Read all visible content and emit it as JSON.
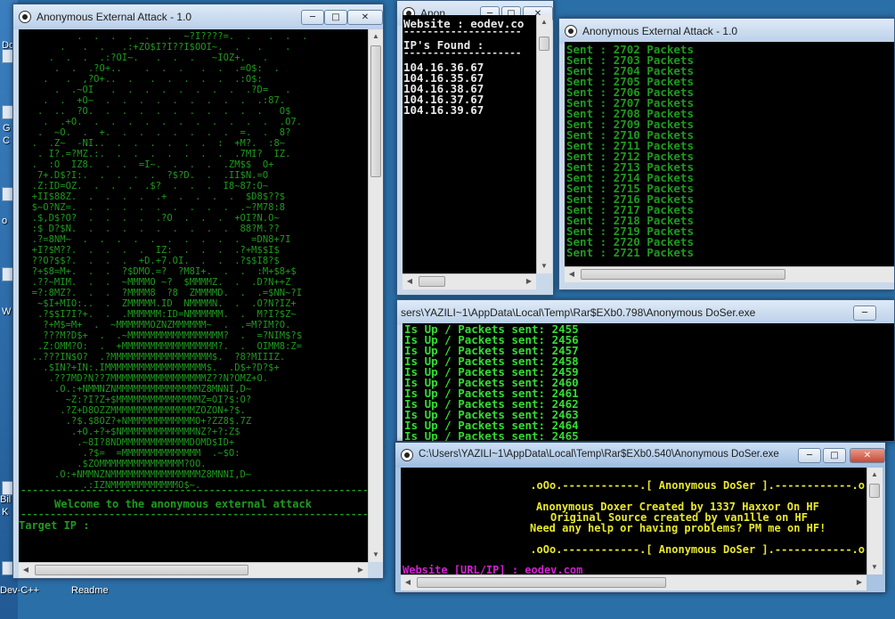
{
  "desktop": {
    "left_labels": [
      "Do",
      "G",
      "C",
      "o",
      "Bil",
      "K",
      "W"
    ],
    "bottom_labels": [
      "Dev-C++",
      "Readme"
    ]
  },
  "win1": {
    "title": "Anonymous External Attack - 1.0",
    "ascii_art": "          .  .  .  .  .   .  ~?I????=.  .   .  .  .\n       .   .  .   .:+ZO$I?I??I$OOI~.  .   .    .\n     .  .  .  .:?OI~.   .  .  .   ~IOZ+.   .\n      .  .  .?O+..    .  .  .   .  .  .=O$:  .\n    .   .  ,?O+..  .   .  .  .  .  .  .:O$:\n      .  .~OI   .  .  .  .  .  .  .  .  .?D=   .\n    .  .  +O~  .  .  .  .  .  .  .  .  .  .:87.\n   .  ..  ?O.  .  .  .  .  .  .  .  .  .  .   O$\n    .  .+O.  .  .  .  .  .  .  .  .  .  .  .  .O7.\n   .  ~O.  .  +.  .  .  .  .  .  .  .  =.  .  8?\n  .  .Z~  -NI..  .  .  .  .  .  .  :  +M?.  :8~\n   . I?.=?MZ.:.  .  .  .  .  .  .  .  .7MI?  IZ.\n  .  :O  IZ8.  .  .  =I~.  .  .  .  .ZM$$  O+\n   7+.D$?I:.  .  .  .  .  ?$?D.  .  .II$N.=O\n  .Z:ID=OZ.  .  .  .  .$?  .  .  .  I8~87:O~\n  +II$88Z.  .  .  .  .  .+  .  .  .  .  $D8$??$\n  $~O?NZ=.  .  .  .  .  .  .  .  .  .  .~?M78:8\n  .$,D$?O?  .  .  .  .  .?O  .  .  .  +OI?N.O~\n  :$ D?$N.  .  .  .  .  .  .  .  .  .  88?M.??\n  .?=8NM~  .  .  .  .  .  .  .  .  .  .  =DN8+7I\n  +I?$M??.  .  .  .  .  IZ:  .  .  .  .?+M$$I$\n  ??O?$$?.  .  .  .  +D.+7.OI.  .  .  .?$$I8?$\n  ?+$8=M+.  .  .  ?$DMO.=?  ?M8I+.  .  .  :M+$8+$\n  .??~MIM.  .  .  ~MMMMO ~?  $MMMMZ.  .  .D?N++Z\n  =?:8MZ?.  .  .  ?MMMM8  ?8  ZMMMMD.  .  .=$NN~?I\n   ~$I+MIO:..  .  ZMMMMM.ID  NMMMMN.  .  .O?N?IZ+\n   .?$$I7I?+.  .  .MMMMMM:ID=NMMMMMM.  .  M?I?$Z~\n    ?+M$=M+  .  ~MMMMMMOZNZMMMMMM~  .  .=M?IM?O.\n    ???M?D$+  .  .~MMMMMMMMMMMMMMMMM?  .  =?NIM$?$\n   .Z:OMM?O:  .  +MMMMMMMMMMMMMMMMM?.  .  OIMM8:Z=\n  ..???IN$O?  .?MMMMMMMMMMMMMMMMMM$.  ?8?MIIIZ.\n    .$IN?+IN:.IMMMMMMMMMMMMMMMMMM$.  .D$+?D?$+\n     .??7MD?N??7MMMMMMMMMMMMMMMMMZ??N?OMZ+O.\n      .O.:+NMMNZNMMMMMMMMMMMMMMMZ8MNNI,D~\n        ~Z:?I?Z+$MMMMMMMMMMMMMMMZ=OI?$:O?\n       .?Z+D8OZZMMMMMMMMMMMMMMMZOZON+?$.\n        .?$.$8OZ?+NMMMMMMMMMMMMO+?ZZ8$.7Z\n         .+O.+?+$NMMMMMMMMMMMMMNZ?+?:Z$\n          .~8I?8NDMMMMMMMMMMMMDOMD$ID+\n           .?$=  =MMMMMMMMMMMMMM  .~$O:\n          .$ZOMMMMMMMMMMMMMMM?OO.\n      .O:+NMMNZNMMMMMMMMMMMMMMMMZ8MNNI,D~\n           .:IZNMMMMMMMMMMMMO$~.",
    "separator": "------------------------------------------------------------",
    "welcome": "Welcome to the anonymous external attack",
    "prompt": "Target IP :"
  },
  "win2": {
    "title": "Anon...",
    "website_line": "Website : eodev.co",
    "found_line": "IP's Found :",
    "separator": "--------------------",
    "ips": [
      "104.16.36.67",
      "104.16.35.67",
      "104.16.38.67",
      "104.16.37.67",
      "104.16.39.67"
    ]
  },
  "win3": {
    "title": "Anonymous External Attack - 1.0",
    "sent_lines": [
      "Sent : 2702 Packets",
      "Sent : 2703 Packets",
      "Sent : 2704 Packets",
      "Sent : 2705 Packets",
      "Sent : 2706 Packets",
      "Sent : 2707 Packets",
      "Sent : 2708 Packets",
      "Sent : 2709 Packets",
      "Sent : 2710 Packets",
      "Sent : 2711 Packets",
      "Sent : 2712 Packets",
      "Sent : 2713 Packets",
      "Sent : 2714 Packets",
      "Sent : 2715 Packets",
      "Sent : 2716 Packets",
      "Sent : 2717 Packets",
      "Sent : 2718 Packets",
      "Sent : 2719 Packets",
      "Sent : 2720 Packets",
      "Sent : 2721 Packets"
    ]
  },
  "win4": {
    "title": "sers\\YAZILI~1\\AppData\\Local\\Temp\\Rar$EXb0.798\\Anonymous DoSer.exe",
    "lines": [
      "Is Up / Packets sent: 2455",
      "Is Up / Packets sent: 2456",
      "Is Up / Packets sent: 2457",
      "Is Up / Packets sent: 2458",
      "Is Up / Packets sent: 2459",
      "Is Up / Packets sent: 2460",
      "Is Up / Packets sent: 2461",
      "Is Up / Packets sent: 2462",
      "Is Up / Packets sent: 2463",
      "Is Up / Packets sent: 2464",
      "Is Up / Packets sent: 2465"
    ]
  },
  "win5": {
    "title": "C:\\Users\\YAZILI~1\\AppData\\Local\\Temp\\Rar$EXb0.540\\Anonymous DoSer.exe",
    "banner1": ".oOo.------------.[ Anonymous DoSer ].------------.o",
    "credit1": "Anonymous Doxer Created by 1337 Haxxor On HF",
    "credit2": "Original Source created by van1lle on HF",
    "credit3": "Need any help or having problems? PM me on HF!",
    "banner2": ".oOo.------------.[ Anonymous DoSer ].------------.o",
    "input_line": "Website [URL/IP] : eodev.com"
  },
  "colors": {
    "console_green": "#1f9a1f",
    "bright_green": "#33dd33",
    "yellow": "#e8e82a",
    "magenta": "#d020d0",
    "white": "#e8e8e8"
  }
}
